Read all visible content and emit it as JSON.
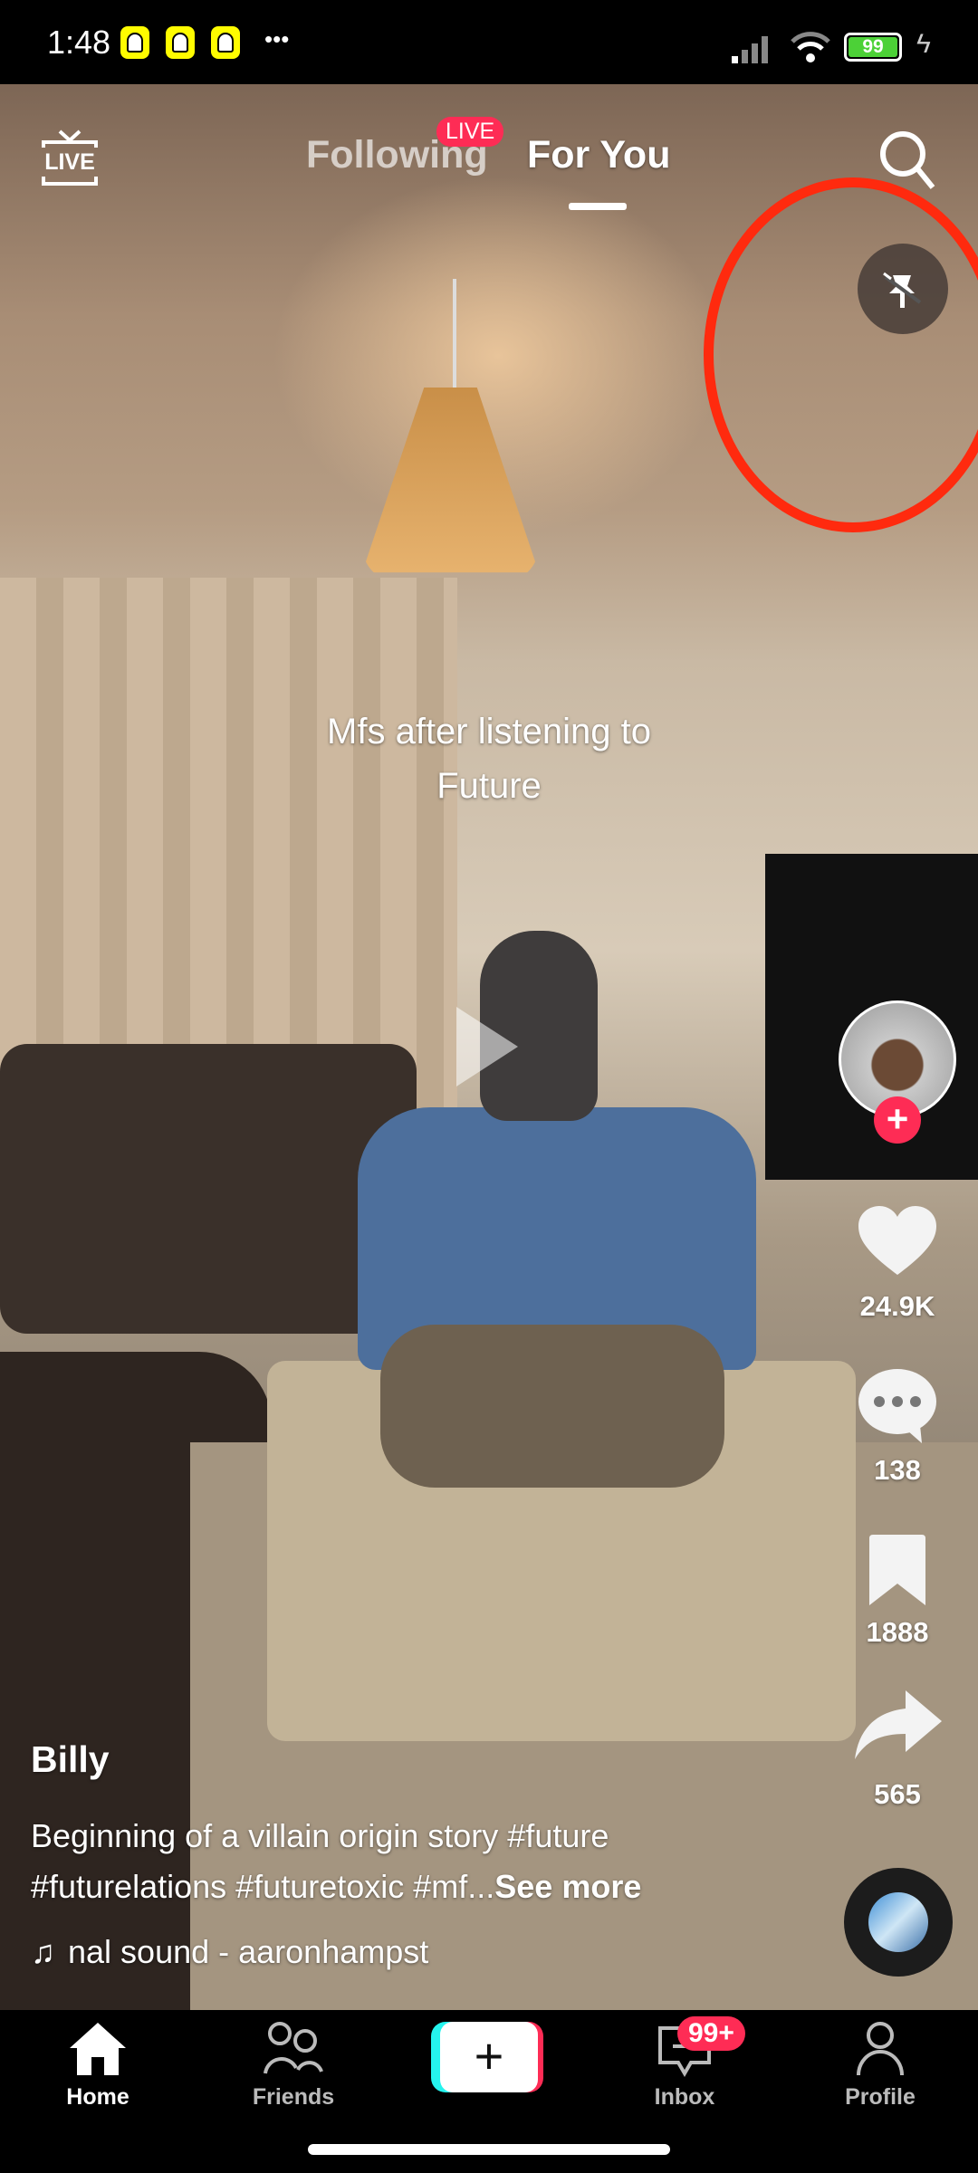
{
  "status_bar": {
    "time": "1:48",
    "battery": "99",
    "more": "•••",
    "notification_icons": [
      "snapchat-icon",
      "snapchat-icon",
      "snapchat-icon"
    ]
  },
  "header": {
    "live_icon_label": "LIVE",
    "tabs": [
      {
        "label": "Following",
        "badge": "LIVE"
      },
      {
        "label": "For You",
        "active": true
      }
    ]
  },
  "video": {
    "caption_line1": "Mfs after listening to",
    "caption_line2": "Future",
    "state": "paused"
  },
  "actions": {
    "likes": "24.9K",
    "comments": "138",
    "bookmarks": "1888",
    "shares": "565"
  },
  "post": {
    "username": "Billy",
    "description_line1": "Beginning of a villain origin story #future",
    "description_line2": "#futurelations #futuretoxic #mf...",
    "see_more": "See more",
    "sound": "nal sound - aaronhampst"
  },
  "nav": {
    "items": [
      {
        "label": "Home"
      },
      {
        "label": "Friends"
      },
      {
        "label": "Inbox",
        "badge": "99+"
      },
      {
        "label": "Profile"
      }
    ]
  },
  "colors": {
    "badge": "#fe2c55",
    "annotation": "#ff2a0e",
    "battery": "#4cd137"
  }
}
